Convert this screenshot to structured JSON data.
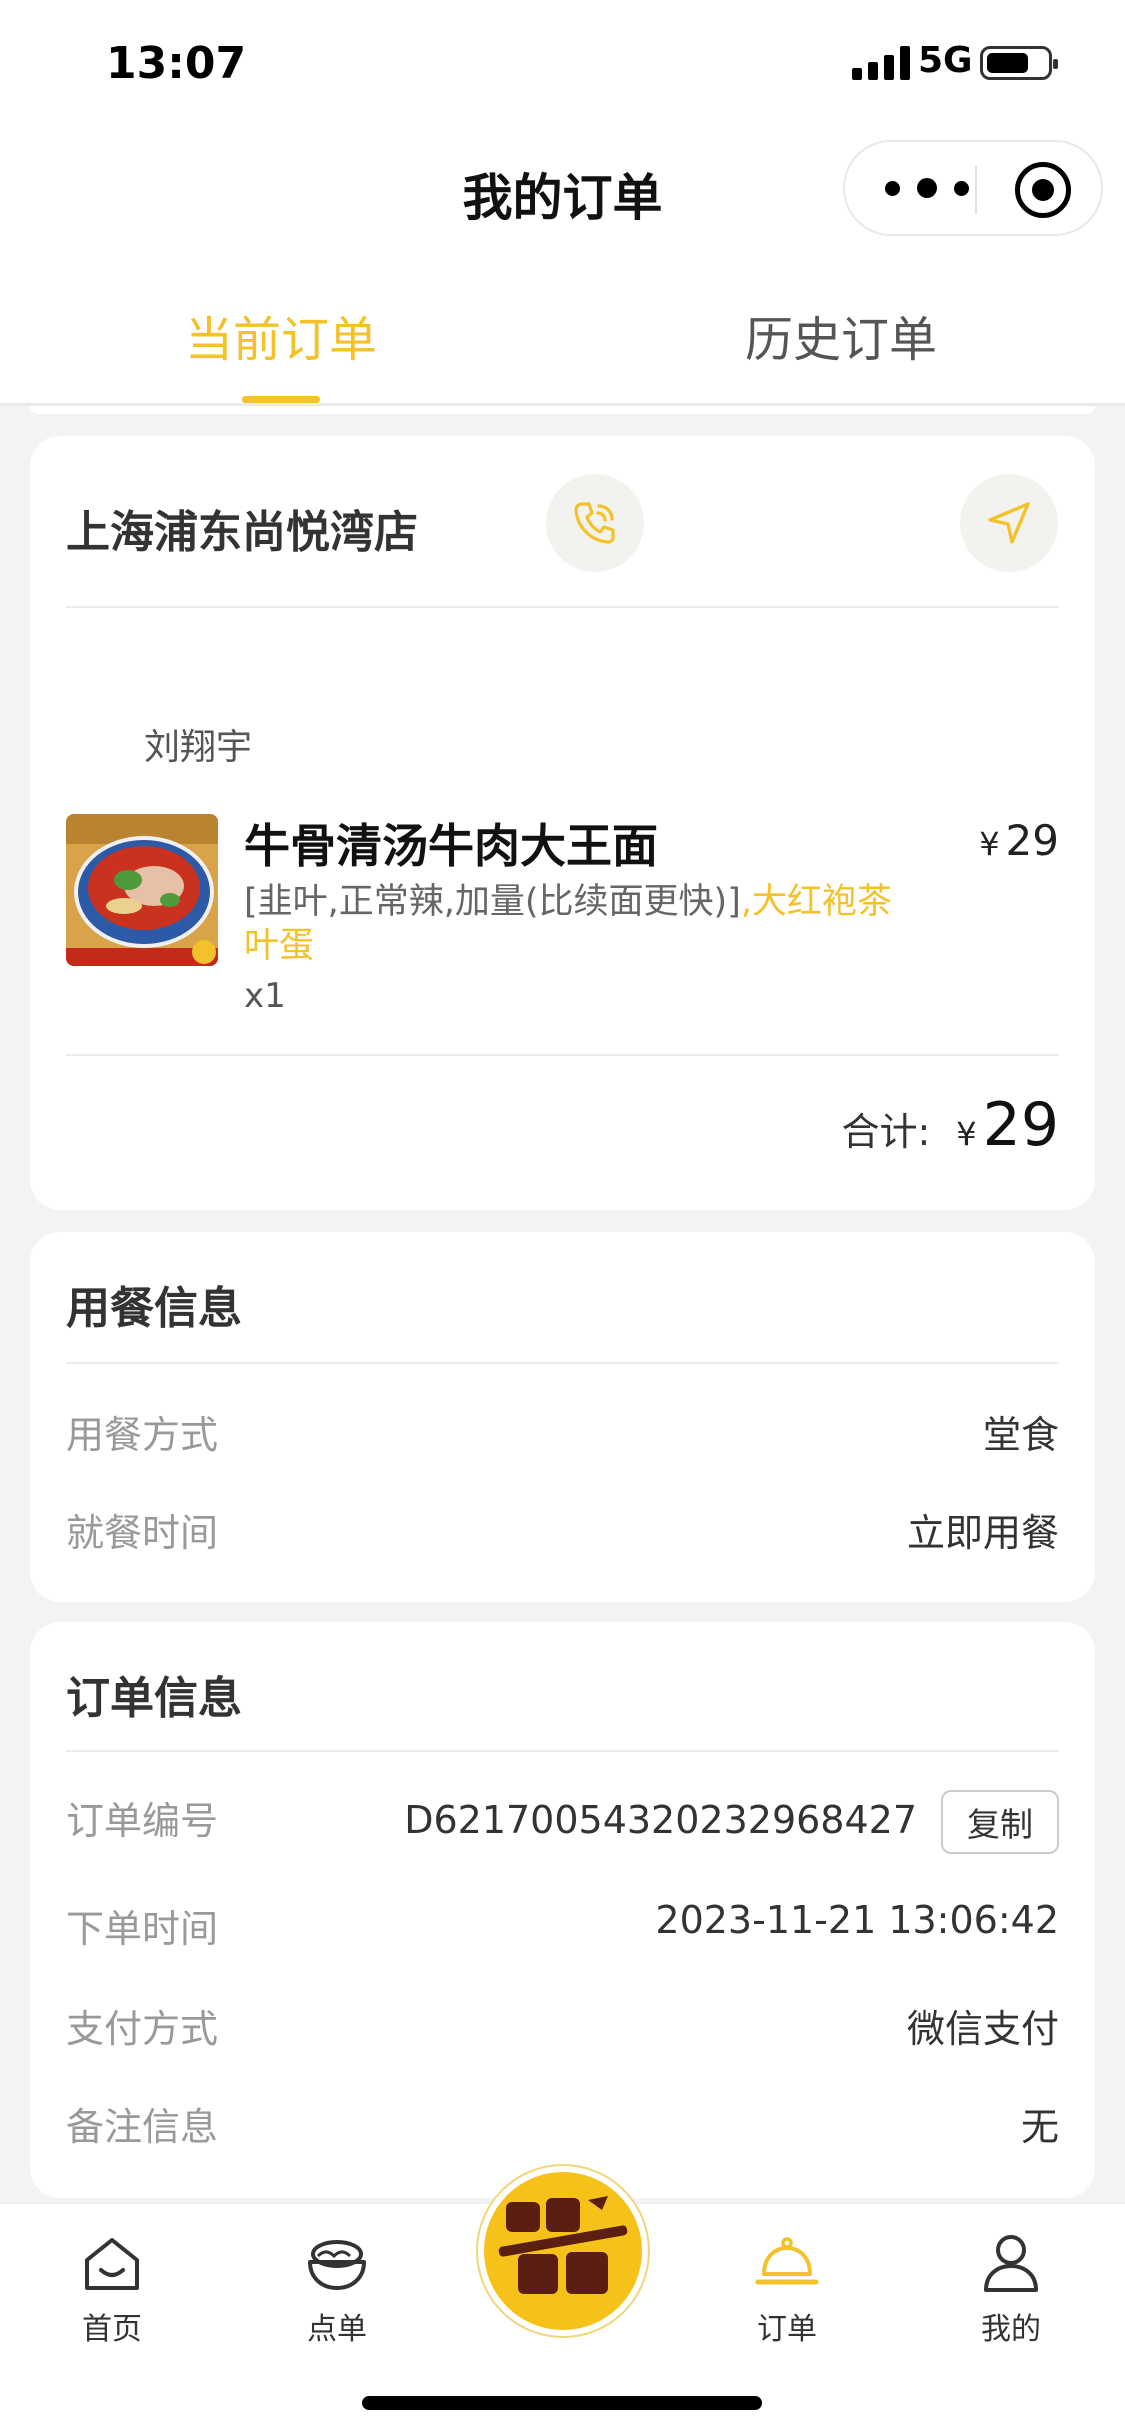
{
  "status_bar": {
    "time": "13:07",
    "network": "5G",
    "battery_level": 0.7
  },
  "nav": {
    "title": "我的订单"
  },
  "tabs": [
    {
      "label": "当前订单",
      "active": true
    },
    {
      "label": "历史订单",
      "active": false
    }
  ],
  "order": {
    "store_name": "上海浦东尚悦湾店",
    "person": "刘翔宇",
    "item": {
      "name": "牛骨清汤牛肉大王面",
      "currency": "¥",
      "price": "29",
      "spec_plain": "[韭叶,正常辣,加量(比续面更快)]",
      "spec_highlight": ",大红袍茶叶蛋",
      "qty": "x1"
    },
    "total_label": "合计:",
    "total_currency": "¥",
    "total": "29"
  },
  "dining": {
    "title": "用餐信息",
    "rows": [
      {
        "label": "用餐方式",
        "value": "堂食"
      },
      {
        "label": "就餐时间",
        "value": "立即用餐"
      }
    ]
  },
  "order_info": {
    "title": "订单信息",
    "order_no_label": "订单编号",
    "order_no": "D62170054320232968427",
    "copy_label": "复制",
    "time_label": "下单时间",
    "time": "2023-11-21 13:06:42",
    "pay_label": "支付方式",
    "pay": "微信支付",
    "note_label": "备注信息",
    "note": "无"
  },
  "tabbar": {
    "items": [
      {
        "label": "首页",
        "icon": "home-icon"
      },
      {
        "label": "点单",
        "icon": "noodle-bowl-icon"
      },
      {
        "label": "订单",
        "icon": "cloche-icon",
        "active": true
      },
      {
        "label": "我的",
        "icon": "user-icon"
      }
    ],
    "center_badge_icon": "super-crazy-tuesday-logo"
  },
  "colors": {
    "accent": "#f3c12a",
    "background": "#f3f3f3"
  }
}
